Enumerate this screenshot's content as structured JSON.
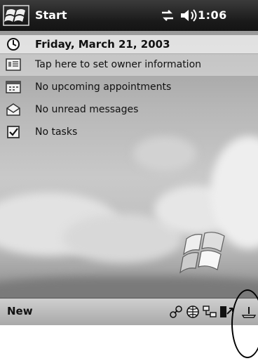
{
  "titlebar": {
    "start_label": "Start",
    "clock": "1:06"
  },
  "today": {
    "date": "Friday, March 21, 2003",
    "items": [
      {
        "label": "Tap here to set owner information",
        "icon": "owner-card-icon"
      },
      {
        "label": "No upcoming appointments",
        "icon": "calendar-icon"
      },
      {
        "label": "No unread messages",
        "icon": "inbox-envelope-icon"
      },
      {
        "label": "No tasks",
        "icon": "tasks-checkbox-icon"
      }
    ]
  },
  "menubar": {
    "new_label": "New",
    "tray_icons": [
      "connection-icon",
      "globe-icon",
      "network-icon",
      "sync-icon",
      "input-panel-icon"
    ]
  }
}
